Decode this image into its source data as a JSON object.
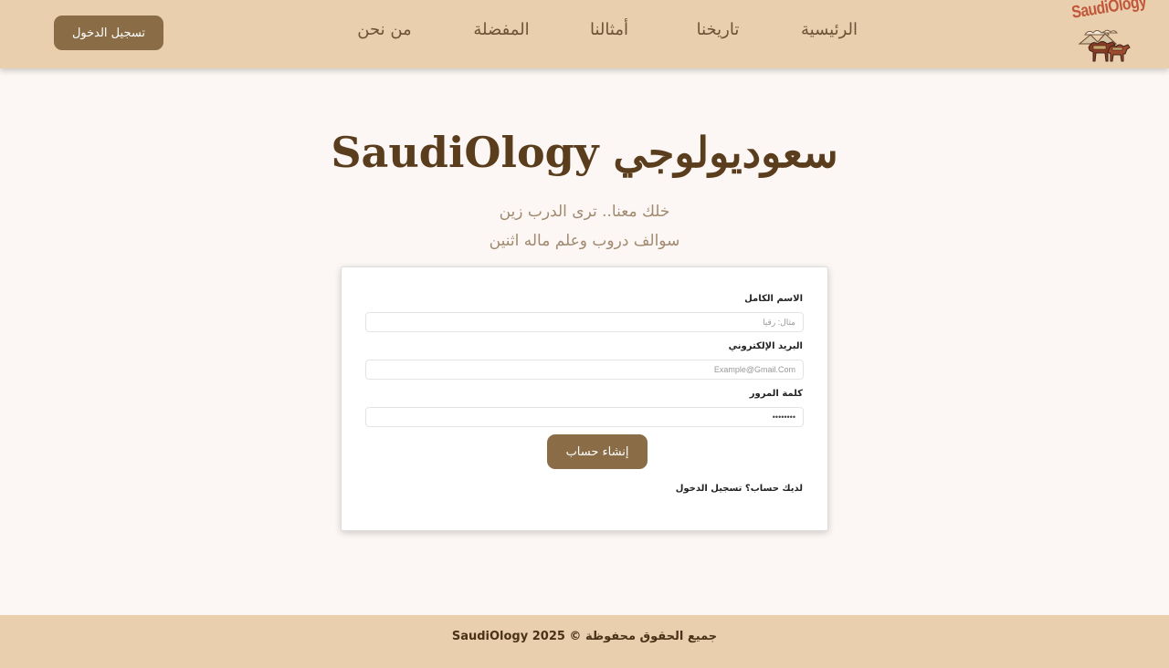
{
  "header": {
    "login_button": "تسجيل الدخول",
    "nav": {
      "home": "الرئيسية",
      "history": "تاريخنا",
      "proverbs": "أمثالنا",
      "favorites": "المفضلة",
      "about": "من نحن"
    },
    "logo_text": "SaudiOlogy"
  },
  "hero": {
    "title": "سعوديولوجي SaudiOlogy",
    "tagline_line1": "خلك معنا.. ترى الدرب زين",
    "tagline_line2": "سوالف دروب وعلم ماله اثنين"
  },
  "form": {
    "full_name_label": "الاسم الكامل",
    "full_name_placeholder": "مثال: رقيا",
    "email_label": "البريد الإلكتروني",
    "email_placeholder": "Example@Gmail.Com",
    "password_label": "كلمة المرور",
    "password_value": "••••••••",
    "submit_label": "إنشاء حساب",
    "has_account_text": "لديك حساب؟",
    "login_link": "تسجيل الدخول"
  },
  "footer": {
    "text": "جميع الحقوق محفوظة © SaudiOlogy 2025"
  },
  "colors": {
    "header_bg": "#e9cfae",
    "button_bg": "#8a6d47",
    "title_color": "#5a3d1c",
    "page_bg": "#fcf7f4"
  }
}
